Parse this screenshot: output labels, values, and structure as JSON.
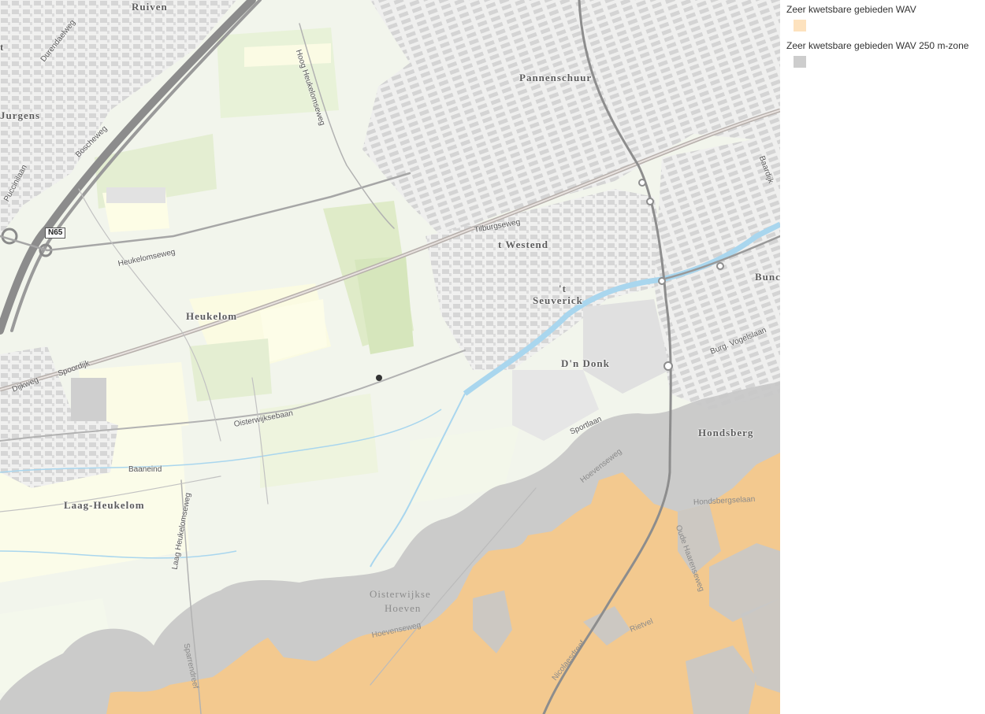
{
  "map": {
    "places": [
      {
        "name": "Ruiven"
      },
      {
        "name": "Jurgens"
      },
      {
        "name": "Pannenschuur"
      },
      {
        "name": "t Westend"
      },
      {
        "name": "'t"
      },
      {
        "name": "Seuverick"
      },
      {
        "name": "Heukelom"
      },
      {
        "name": "D'n Donk"
      },
      {
        "name": "Hondsberg"
      },
      {
        "name": "Bunc"
      },
      {
        "name": "Laag-Heukelom"
      },
      {
        "name": "Oisterwijkse"
      },
      {
        "name": "Hoeven"
      },
      {
        "name": "t"
      }
    ],
    "streets": [
      {
        "name": "Durendaelweg"
      },
      {
        "name": "Hoog Heukelomseweg"
      },
      {
        "name": "Boscheweg"
      },
      {
        "name": "Puccinilaan"
      },
      {
        "name": "Heukelomseweg"
      },
      {
        "name": "Tilburgseweg"
      },
      {
        "name": "Spoordijk"
      },
      {
        "name": "Dijkweg"
      },
      {
        "name": "Oisterwijksebaan"
      },
      {
        "name": "Sportlaan"
      },
      {
        "name": "Burg. Vogelslaan"
      },
      {
        "name": "Baardijk"
      },
      {
        "name": "Baaneind"
      },
      {
        "name": "Laag Heukelomseweg"
      },
      {
        "name": "Hoevenseweg"
      },
      {
        "name": "Hondsbergselaan"
      },
      {
        "name": "Oude Haarenseweg"
      },
      {
        "name": "Rietvel"
      },
      {
        "name": "Hoevenseweg"
      },
      {
        "name": "Sparrendreef"
      },
      {
        "name": "Nicolaesdreef"
      }
    ],
    "road_shield": "N65",
    "colors": {
      "base": "#f2f5ec",
      "urban_block": "#dedede",
      "wav_zone": "#ffe0b0",
      "wav_250m_zone": "#c8c8c8",
      "water": "#a9d6ee",
      "road": "#8a8a8a"
    }
  },
  "legend": {
    "items": [
      {
        "label": "Zeer kwetsbare gebieden WAV",
        "color": "#fde2be"
      },
      {
        "label": "Zeer kwetsbare gebieden WAV 250 m-zone",
        "color": "#cdcdcd"
      }
    ]
  }
}
